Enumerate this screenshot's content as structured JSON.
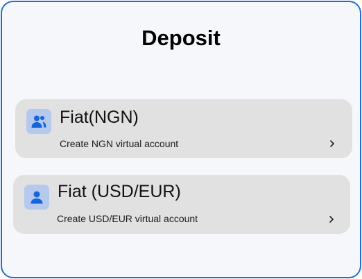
{
  "page": {
    "title": "Deposit"
  },
  "options": [
    {
      "title": "Fiat(NGN)",
      "subtitle": "Create NGN virtual account",
      "icon": "users-icon"
    },
    {
      "title": "Fiat (USD/EUR)",
      "subtitle": "Create USD/EUR virtual account",
      "icon": "user-icon"
    }
  ],
  "colors": {
    "border": "#1f6fd1",
    "background": "#f6f7fb",
    "card": "#e1e1e1",
    "icon_bg": "#b5c9ef",
    "icon_fg": "#1565d8"
  }
}
